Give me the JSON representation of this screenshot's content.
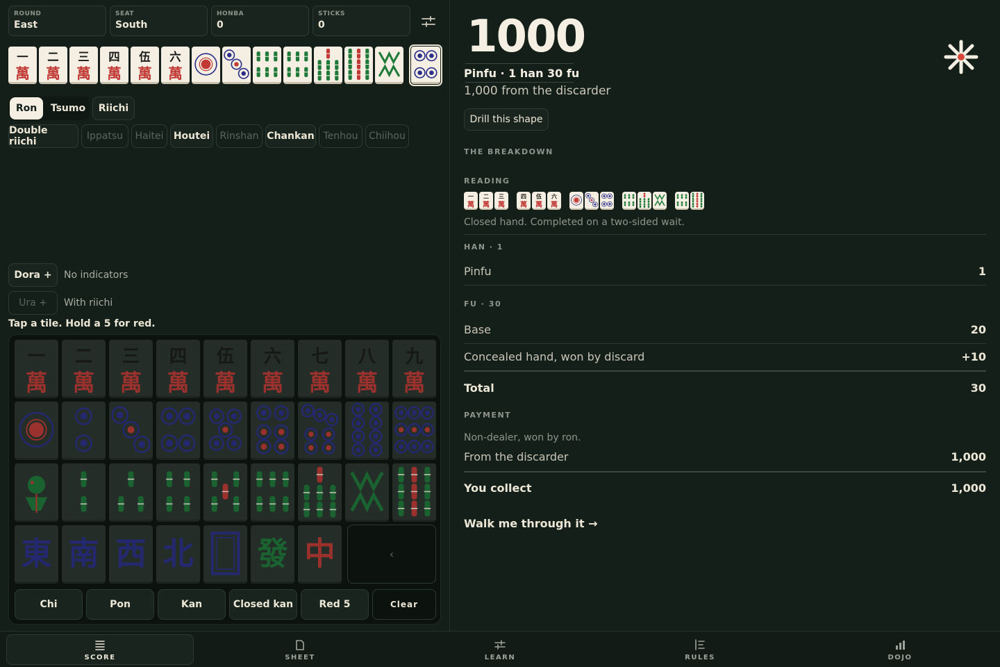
{
  "header": {
    "round_label": "ROUND",
    "round_value": "East",
    "seat_label": "SEAT",
    "seat_value": "South",
    "honba_label": "HONBA",
    "honba_value": "0",
    "sticks_label": "STICKS",
    "sticks_value": "0"
  },
  "hand": [
    "m1",
    "m2",
    "m3",
    "m4",
    "m5",
    "m6",
    "p1",
    "p3",
    "s6",
    "s6",
    "s7",
    "s9",
    "s8"
  ],
  "winning_tile": "p4",
  "win_mode": {
    "ron": "Ron",
    "tsumo": "Tsumo",
    "riichi": "Riichi",
    "selected": "Ron"
  },
  "yaku_toggles": [
    {
      "label": "Double riichi",
      "state": "enabled"
    },
    {
      "label": "Ippatsu",
      "state": "disabled"
    },
    {
      "label": "Haitei",
      "state": "disabled"
    },
    {
      "label": "Houtei",
      "state": "enabled"
    },
    {
      "label": "Rinshan",
      "state": "disabled"
    },
    {
      "label": "Chankan",
      "state": "enabled"
    },
    {
      "label": "Tenhou",
      "state": "disabled"
    },
    {
      "label": "Chiihou",
      "state": "disabled"
    }
  ],
  "dora": {
    "button": "Dora +",
    "text": "No indicators"
  },
  "ura": {
    "button": "Ura +",
    "text": "With riichi"
  },
  "pad": {
    "hint": "Tap a tile. Hold a 5 for red.",
    "rows": [
      [
        "m1",
        "m2",
        "m3",
        "m4",
        "m5",
        "m6",
        "m7",
        "m8",
        "m9"
      ],
      [
        "p1",
        "p2",
        "p3",
        "p4",
        "p5",
        "p6",
        "p7",
        "p8",
        "p9"
      ],
      [
        "s1",
        "s2",
        "s3",
        "s4",
        "s5",
        "s6",
        "s7",
        "s8",
        "s9"
      ],
      [
        "z1",
        "z2",
        "z3",
        "z4",
        "z5",
        "z6",
        "z7"
      ]
    ],
    "backspace": "‹",
    "buttons": [
      "Chi",
      "Pon",
      "Kan",
      "Closed kan",
      "Red 5",
      "Clear"
    ]
  },
  "result": {
    "score": "1000",
    "summary": "Pinfu · 1 han 30 fu",
    "from": "1,000 from the discarder",
    "drill": "Drill this shape",
    "breakdown_title": "THE BREAKDOWN",
    "reading_title": "READING",
    "reading_groups": [
      [
        "m1",
        "m2",
        "m3"
      ],
      [
        "m4",
        "m5",
        "m6"
      ],
      [
        "p1",
        "p3",
        "p4"
      ],
      [
        "s6",
        "s7",
        "s8"
      ],
      [
        "s6",
        "s9"
      ]
    ],
    "reading_note": "Closed hand. Completed on a two-sided wait.",
    "han_title": "HAN · 1",
    "han_rows": [
      {
        "label": "Pinfu",
        "value": "1"
      }
    ],
    "fu_title": "FU · 30",
    "fu_rows": [
      {
        "label": "Base",
        "value": "20"
      },
      {
        "label": "Concealed hand, won by discard",
        "value": "+10"
      }
    ],
    "fu_total_label": "Total",
    "fu_total": "30",
    "payment_title": "PAYMENT",
    "payment_note": "Non-dealer, won by ron.",
    "payment_rows": [
      {
        "label": "From the discarder",
        "value": "1,000"
      }
    ],
    "collect_label": "You collect",
    "collect_value": "1,000",
    "walk": "Walk me through it →"
  },
  "nav": [
    {
      "label": "SCORE",
      "icon": "score-icon",
      "active": true
    },
    {
      "label": "SHEET",
      "icon": "sheet-icon",
      "active": false
    },
    {
      "label": "LEARN",
      "icon": "learn-icon",
      "active": false
    },
    {
      "label": "RULES",
      "icon": "rules-icon",
      "active": false
    },
    {
      "label": "DOJO",
      "icon": "dojo-icon",
      "active": false
    }
  ],
  "colors": {
    "bg": "#141f19",
    "panel": "#18241d",
    "ivory": "#f4efe2",
    "tile_red": "#c23a36",
    "tile_green": "#1f7a3a",
    "tile_blue": "#2b2f8a"
  }
}
